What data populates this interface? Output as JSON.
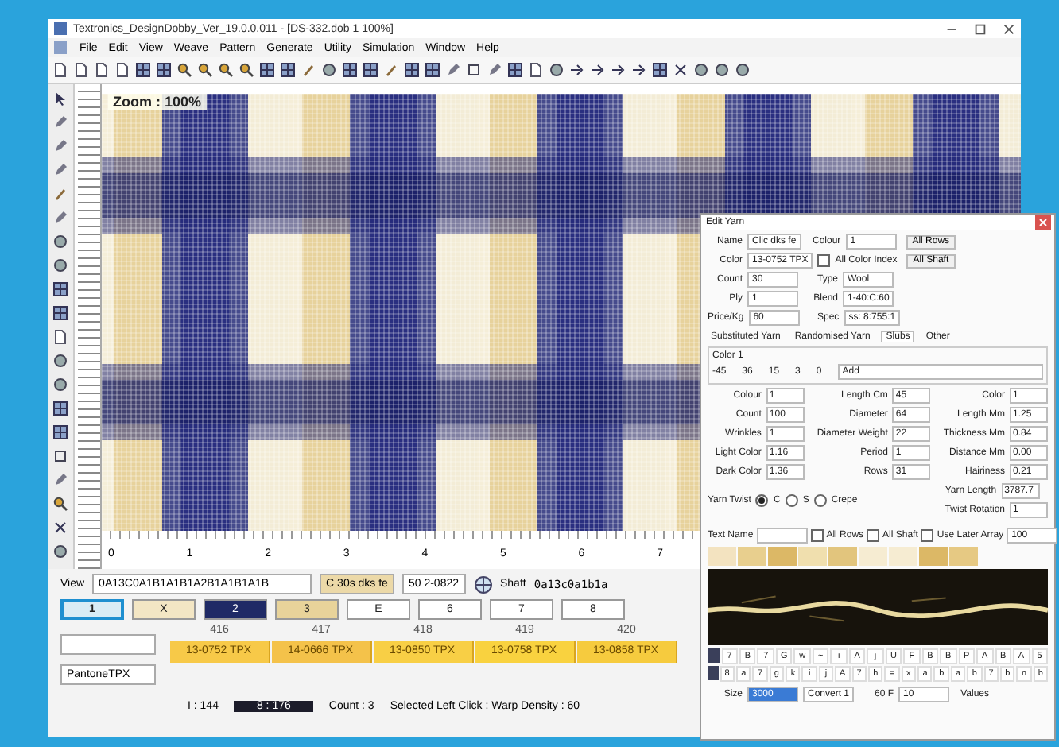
{
  "window": {
    "title": "Textronics_DesignDobby_Ver_19.0.0.011 - [DS-332.dob 1 100%]"
  },
  "menu": [
    "File",
    "Edit",
    "View",
    "Weave",
    "Pattern",
    "Generate",
    "Utility",
    "Simulation",
    "Window",
    "Help"
  ],
  "canvas": {
    "zoom_label": "Zoom : 100%",
    "ruler_marks": [
      "0",
      "1",
      "2",
      "3",
      "4",
      "5",
      "6",
      "7"
    ]
  },
  "view_bar": {
    "label": "View",
    "sequence": "0A13C0A1B1A1B1A2B1A1B1A1B",
    "yarn_a": "C 30s dks fe",
    "yarn_b": "50 2-0822",
    "shaft_label": "Shaft",
    "shaft_sequence": "0a13c0a1b1a"
  },
  "color_slots": [
    {
      "label": "1",
      "color": "#d9ecf5",
      "selected": true
    },
    {
      "label": "X",
      "color": "#f3e6c4",
      "selected": false
    },
    {
      "label": "2",
      "color": "#1f2a66",
      "selected": false
    },
    {
      "label": "3",
      "color": "#e8d39a",
      "selected": false
    },
    {
      "label": "E",
      "color": "#ffffff",
      "selected": false
    },
    {
      "label": "6",
      "color": "#ffffff",
      "selected": false
    },
    {
      "label": "7",
      "color": "#ffffff",
      "selected": false
    },
    {
      "label": "8",
      "color": "#ffffff",
      "selected": false
    }
  ],
  "yarn_library": {
    "palette": "PantoneTPX",
    "columns": [
      {
        "number": "416",
        "code": "13-0752 TPX",
        "color": "#f7c948"
      },
      {
        "number": "417",
        "code": "14-0666 TPX",
        "color": "#f4c24a"
      },
      {
        "number": "418",
        "code": "13-0850 TPX",
        "color": "#f8cf45"
      },
      {
        "number": "419",
        "code": "13-0758 TPX",
        "color": "#f9d23f"
      },
      {
        "number": "420",
        "code": "13-0858 TPX",
        "color": "#f6cb3e"
      }
    ]
  },
  "status": {
    "left": "I : 144",
    "dark": "8 : 176",
    "count": "Count : 3",
    "message": "Selected Left Click : Warp Density : 60"
  },
  "edit_yarn": {
    "title": "Edit Yarn",
    "rows": [
      {
        "label": "Name",
        "value": "Clic dks fe",
        "label2": "Colour",
        "value2": "1",
        "button": "All Rows"
      },
      {
        "label": "Color",
        "value": "13-0752 TPX",
        "checkbox": "All Color Index",
        "checked": false,
        "button": "All Shaft"
      },
      {
        "label": "Count",
        "value": "30",
        "label2": "Type",
        "value2": "Wool"
      },
      {
        "label": "Ply",
        "value": "1",
        "label2": "Blend",
        "value2": "1-40:C:60"
      },
      {
        "label": "Price/Kg",
        "value": "60",
        "label2": "Spec",
        "value2": "ss: 8:755:1"
      }
    ],
    "tabs": [
      {
        "label": "Substituted Yarn",
        "selected": false
      },
      {
        "label": "Randomised Yarn",
        "selected": false
      },
      {
        "label": "Slubs",
        "selected": true
      },
      {
        "label": "Other",
        "selected": false
      }
    ],
    "group": {
      "title": "Color 1",
      "values": [
        "-45",
        "36",
        "15",
        "3",
        "0"
      ],
      "field": "Add"
    },
    "params": [
      {
        "label": "Colour",
        "value": "1",
        "label2": "Length Cm",
        "value2": "45",
        "label3": "Color",
        "value3": "1"
      },
      {
        "label": "Count",
        "value": "100",
        "label2": "Diameter",
        "value2": "64",
        "label3": "Length Mm",
        "value3": "1.25"
      },
      {
        "label": "Wrinkles",
        "value": "1",
        "label2": "Diameter Weight",
        "value2": "22",
        "label3": "Thickness Mm",
        "value3": "0.84"
      },
      {
        "label": "Light Color",
        "value": "1.16",
        "label2": "Period",
        "value2": "1",
        "label3": "Distance Mm",
        "value3": "0.00"
      },
      {
        "label": "Dark Color",
        "value": "1.36",
        "label2": "Rows",
        "value2": "31",
        "label3": "Hairiness",
        "value3": "0.21"
      }
    ],
    "twist": {
      "label": "Yarn Twist",
      "options": [
        {
          "label": "C",
          "selected": true
        },
        {
          "label": "S",
          "selected": false
        },
        {
          "label": "Crepe",
          "selected": false
        }
      ],
      "length_label": "Yarn Length",
      "length": "3787.7",
      "rotation_label": "Twist Rotation",
      "rotation": "1"
    },
    "text_name": {
      "label": "Text Name",
      "checks": [
        {
          "label": "All Rows",
          "checked": false
        },
        {
          "label": "All Shaft",
          "checked": false
        },
        {
          "label": "Use Later Array",
          "checked": false
        }
      ],
      "value": "100"
    },
    "swatches": [
      {
        "color": "#f3e3c0"
      },
      {
        "color": "#e8cf8e"
      },
      {
        "color": "#dcb866"
      },
      {
        "color": "#f0dfae"
      },
      {
        "color": "#e2c57d"
      },
      {
        "color": "#f6ecd2"
      },
      {
        "color": "#f6ecd2"
      },
      {
        "color": "#dcb866"
      },
      {
        "color": "#e6c983"
      }
    ],
    "char_rows": [
      [
        "7",
        "B",
        "7",
        "G",
        "w",
        "~",
        "i",
        "A",
        "j",
        "U",
        "F",
        "B",
        "B",
        "P",
        "A",
        "B",
        "A",
        "5"
      ],
      [
        "8",
        "a",
        "7",
        "g",
        "k",
        "i",
        "j",
        "A",
        "7",
        "h",
        "=",
        "x",
        "a",
        "b",
        "a",
        "b",
        "7",
        "b",
        "n",
        "b"
      ]
    ],
    "footer": {
      "size_label": "Size",
      "size": "3000",
      "convert": "Convert 1",
      "value_label": "60 F",
      "value": "10",
      "values_label": "Values"
    }
  }
}
